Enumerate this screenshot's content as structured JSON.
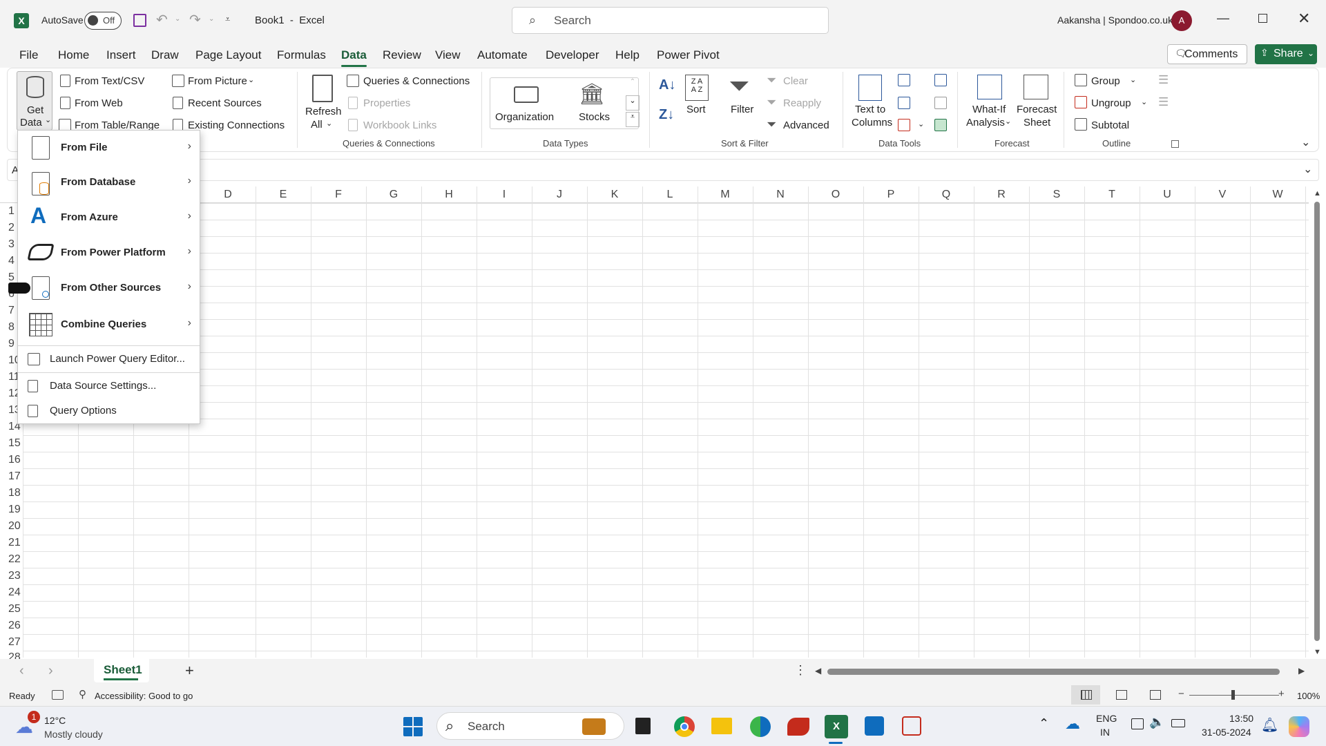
{
  "titlebar": {
    "autosave_label": "AutoSave",
    "autosave_state": "Off",
    "doc_title": "Book1  -  Excel",
    "search_placeholder": "Search",
    "user_name": "Aakansha | Spondoo.co.uk",
    "avatar_initial": "A",
    "brand_color": "#217346"
  },
  "menu": {
    "tabs": [
      "File",
      "Home",
      "Insert",
      "Draw",
      "Page Layout",
      "Formulas",
      "Data",
      "Review",
      "View",
      "Automate",
      "Developer",
      "Help",
      "Power Pivot"
    ],
    "active_tab": "Data",
    "comments_label": "Comments",
    "share_label": "Share"
  },
  "ribbon": {
    "get_data": [
      "Get",
      "Data"
    ],
    "from_text_csv": "From Text/CSV",
    "from_web": "From Web",
    "from_table_range": "From Table/Range",
    "from_picture": "From Picture",
    "recent_sources": "Recent Sources",
    "existing_connections": "Existing Connections",
    "refresh_all": [
      "Refresh",
      "All"
    ],
    "queries_connections": "Queries & Connections",
    "properties": "Properties",
    "workbook_links": "Workbook Links",
    "group_queries": "Queries & Connections",
    "organization": "Organization",
    "stocks": "Stocks",
    "group_data_types": "Data Types",
    "sort": "Sort",
    "filter": "Filter",
    "clear": "Clear",
    "reapply": "Reapply",
    "advanced": "Advanced",
    "group_sort_filter": "Sort & Filter",
    "text_to_columns": [
      "Text to",
      "Columns"
    ],
    "group_data_tools": "Data Tools",
    "what_if": [
      "What-If",
      "Analysis"
    ],
    "forecast_sheet": [
      "Forecast",
      "Sheet"
    ],
    "group_forecast": "Forecast",
    "group_btn": "Group",
    "ungroup_btn": "Ungroup",
    "subtotal_btn": "Subtotal",
    "group_outline": "Outline"
  },
  "namebox": "A",
  "dropdown": {
    "from_file": "From File",
    "from_database": "From Database",
    "from_azure": "From Azure",
    "from_power_platform": "From Power Platform",
    "from_other_sources": "From Other Sources",
    "combine_queries": "Combine Queries",
    "launch_pq": "Launch Power Query Editor...",
    "data_source_settings": "Data Source Settings...",
    "query_options": "Query Options"
  },
  "columns": [
    "D",
    "E",
    "F",
    "G",
    "H",
    "I",
    "J",
    "K",
    "L",
    "M",
    "N",
    "O",
    "P",
    "Q",
    "R",
    "S",
    "T",
    "U",
    "V",
    "W"
  ],
  "rows": [
    "1",
    "2",
    "3",
    "4",
    "5",
    "6",
    "7",
    "8",
    "9",
    "10",
    "11",
    "12",
    "13",
    "14",
    "15",
    "16",
    "17",
    "18",
    "19",
    "20",
    "21",
    "22",
    "23",
    "24",
    "25",
    "26",
    "27",
    "28"
  ],
  "sheet_tab": "Sheet1",
  "status": {
    "ready": "Ready",
    "accessibility": "Accessibility: Good to go",
    "zoom": "100%"
  },
  "taskbar": {
    "weather_badge": "1",
    "temperature": "12°C",
    "weather_desc": "Mostly cloudy",
    "search_label": "Search",
    "lang_line1": "ENG",
    "lang_line2": "IN",
    "time": "13:50",
    "date": "31-05-2024"
  }
}
